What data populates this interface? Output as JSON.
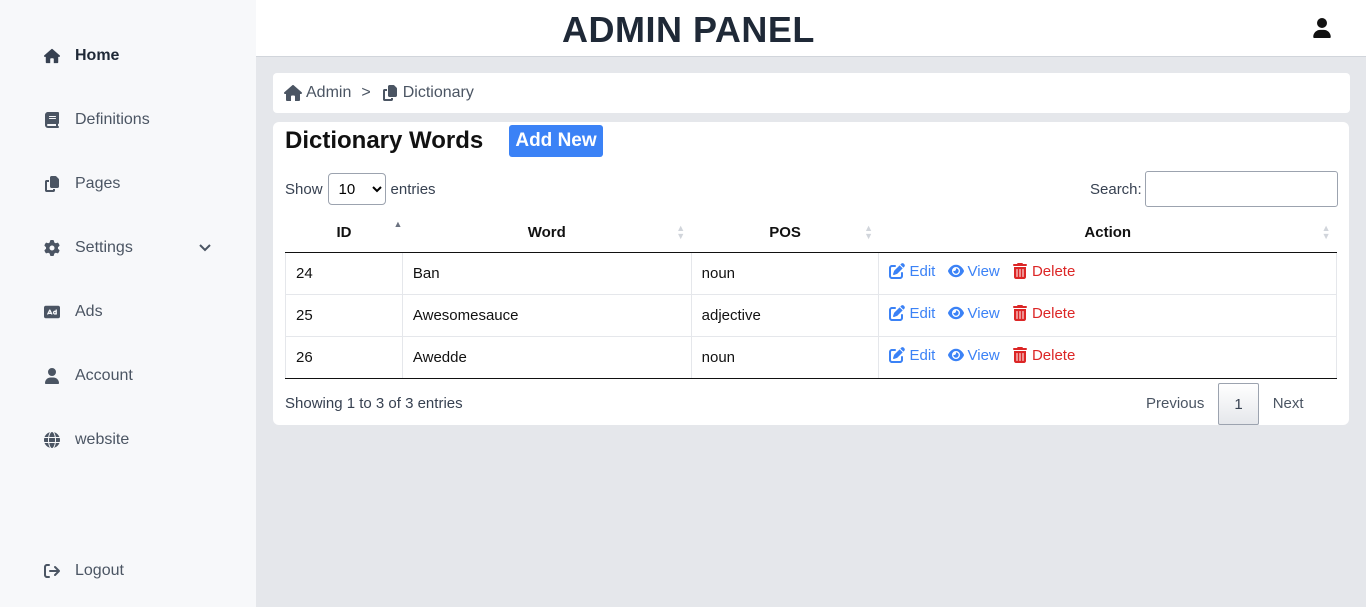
{
  "sidebar": {
    "items": [
      {
        "label": "Home",
        "icon": "home-icon"
      },
      {
        "label": "Definitions",
        "icon": "book-icon"
      },
      {
        "label": "Pages",
        "icon": "copy-icon"
      },
      {
        "label": "Settings",
        "icon": "gear-icon"
      },
      {
        "label": "Ads",
        "icon": "ad-icon"
      },
      {
        "label": "Account",
        "icon": "user-icon"
      },
      {
        "label": "website",
        "icon": "globe-icon"
      }
    ],
    "logout": {
      "label": "Logout",
      "icon": "sign-out-icon"
    }
  },
  "header": {
    "title": "ADMIN PANEL"
  },
  "breadcrumb": {
    "root": "Admin",
    "separator": ">",
    "current": "Dictionary"
  },
  "card": {
    "title": "Dictionary Words",
    "add_label": "Add New"
  },
  "length": {
    "show": "Show",
    "value": "10",
    "entries": "entries"
  },
  "search": {
    "label": "Search:",
    "value": ""
  },
  "table": {
    "columns": [
      "ID",
      "Word",
      "POS",
      "Action"
    ],
    "rows": [
      {
        "id": "24",
        "word": "Ban",
        "pos": "noun"
      },
      {
        "id": "25",
        "word": "Awesomesauce",
        "pos": "adjective"
      },
      {
        "id": "26",
        "word": "Awedde",
        "pos": "noun"
      }
    ],
    "actions": {
      "edit": "Edit",
      "view": "View",
      "delete": "Delete"
    }
  },
  "info": "Showing 1 to 3 of 3 entries",
  "pager": {
    "previous": "Previous",
    "current": "1",
    "next": "Next"
  },
  "colors": {
    "accent": "#3b82f6",
    "danger": "#dc2626",
    "sidebar_bg": "#f7f8fa",
    "page_bg": "#e5e7eb"
  }
}
